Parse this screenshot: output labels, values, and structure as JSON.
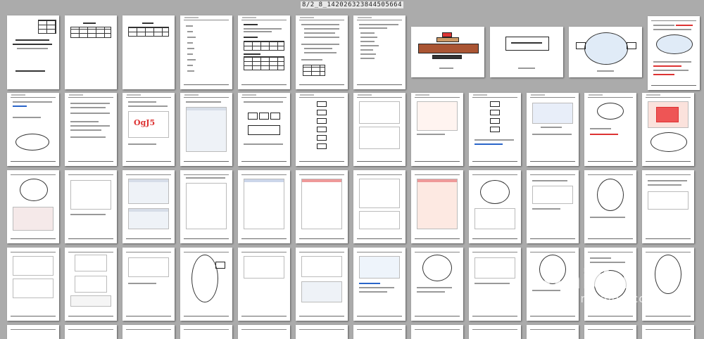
{
  "header": {
    "doc_id": "8/2_8_142026323844505664"
  },
  "watermark": {
    "brand": "Baidu",
    "sub": "jingyan.baidu.com"
  },
  "cover": {
    "red_title": "OgJ5"
  }
}
